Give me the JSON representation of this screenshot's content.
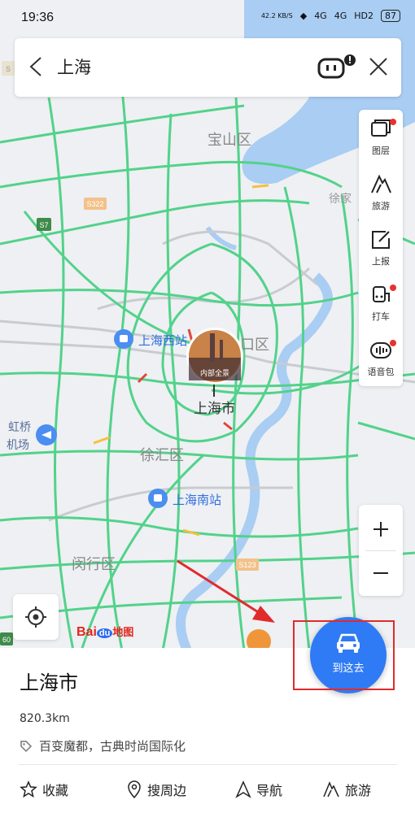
{
  "status": {
    "time": "19:36",
    "speed": "42.2 KB/S",
    "net1": "4G",
    "net2": "4G",
    "hd": "HD2",
    "battery": "87"
  },
  "search": {
    "query": "上海"
  },
  "tools": [
    {
      "label": "图层",
      "badge": true
    },
    {
      "label": "旅游",
      "badge": false
    },
    {
      "label": "上报",
      "badge": false
    },
    {
      "label": "打车",
      "badge": true
    },
    {
      "label": "语音包",
      "badge": true
    }
  ],
  "map": {
    "districts": {
      "baoshan": "宝山区",
      "hongkou": "口区",
      "xuhui": "徐汇区",
      "minhang": "闵行区",
      "xujia": "徐家",
      "hongqiao1": "虹桥",
      "hongqiao2": "机场"
    },
    "stations": {
      "west": "上海西站",
      "south": "上海南站"
    },
    "city": "上海市",
    "roads": {
      "s322": "S322",
      "s7": "S7",
      "s123": "S123",
      "s60": "60",
      "s5": "S"
    },
    "pano": "内部全景"
  },
  "logo": {
    "bai": "Bai",
    "du": "du",
    "tu": "地图"
  },
  "card": {
    "place": "上海市",
    "distance": "820.3km",
    "tag": "百变魔都，古典时尚国际化"
  },
  "go_button": "到这去",
  "actions": [
    {
      "label": "收藏",
      "icon": "star-icon"
    },
    {
      "label": "搜周边",
      "icon": "location-pin-icon"
    },
    {
      "label": "导航",
      "icon": "navigation-arrow-icon"
    },
    {
      "label": "旅游",
      "icon": "travel-icon"
    }
  ],
  "colors": {
    "road": "#52d28a",
    "water": "#a9cdf3",
    "accent": "#2f7bf5",
    "highlight": "#e02b2b"
  }
}
